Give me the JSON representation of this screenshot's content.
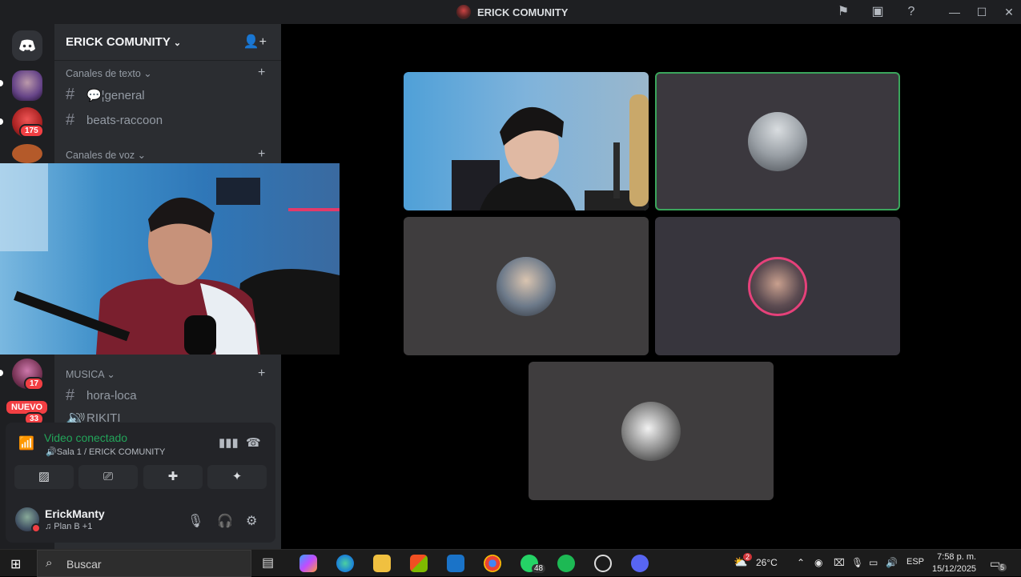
{
  "window": {
    "title": "ERICK COMUNITY"
  },
  "server": {
    "name": "ERICK COMUNITY"
  },
  "guild_badges": [
    "175",
    "17",
    "33"
  ],
  "new_badge": "NUEVO",
  "categories": {
    "text": "Canales de texto",
    "voice": "Canales de voz",
    "music": "MUSICA"
  },
  "text_channels": [
    "💬¦general",
    "beats-raccoon"
  ],
  "music_channels": [
    "hora-loca",
    "RIKITI"
  ],
  "voice_panel": {
    "status": "Video conectado",
    "location": "🔊Sala 1 / ERICK COMUNITY"
  },
  "user": {
    "name": "ErickManty",
    "activity": "♫ Plan B +1"
  },
  "taskbar": {
    "search_placeholder": "Buscar",
    "whatsapp_badge": "48",
    "weather_badge": "2",
    "temperature": "26°C",
    "language": "ESP",
    "time": "7:58 p. m.",
    "date": "15/12/2025",
    "notifications_badge": "5"
  },
  "colors": {
    "accent_green": "#23a55a",
    "badge_red": "#f23f43",
    "sidebar": "#2b2d31",
    "rail": "#1e1f22"
  }
}
